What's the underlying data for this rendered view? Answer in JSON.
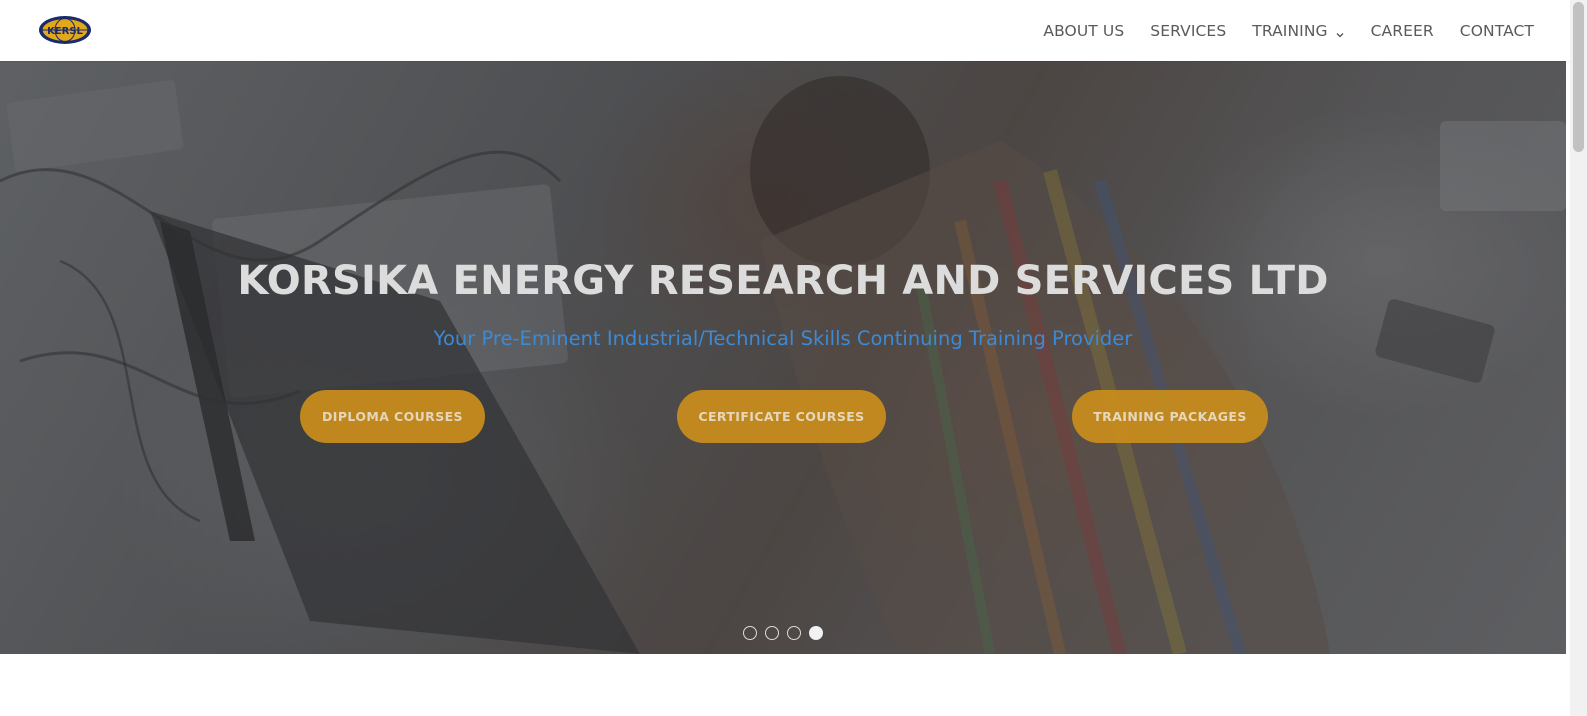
{
  "header": {
    "logo_text": "KERSL",
    "nav": [
      {
        "label": "ABOUT US"
      },
      {
        "label": "SERVICES"
      },
      {
        "label": "TRAINING",
        "has_dropdown": true
      },
      {
        "label": "CAREER"
      },
      {
        "label": "CONTACT"
      }
    ]
  },
  "hero": {
    "title": "KORSIKA ENERGY RESEARCH AND SERVICES LTD",
    "subtitle": "Your Pre-Eminent Industrial/Technical Skills Continuing Training Provider",
    "buttons": [
      {
        "label": "DIPLOMA COURSES"
      },
      {
        "label": "CERTIFICATE COURSES"
      },
      {
        "label": "TRAINING PACKAGES"
      }
    ],
    "slides_total": 4,
    "active_slide": 4
  },
  "colors": {
    "accent_button": "#c98d1c",
    "subtitle": "#3d8ad4",
    "nav_text": "#5a5a5a"
  },
  "icons": [
    "logo-icon",
    "chevron-down-icon"
  ]
}
